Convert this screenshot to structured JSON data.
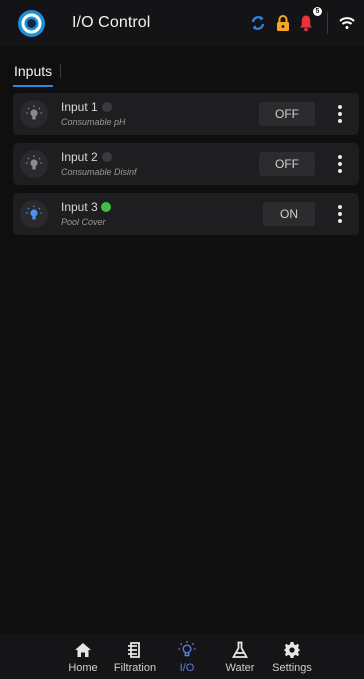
{
  "header": {
    "title": "I/O Control",
    "notification_count": "5",
    "icons": [
      "logo-icon",
      "sync-icon",
      "lock-icon",
      "bell-icon",
      "wifi-icon"
    ],
    "colors": {
      "sync": "#2e88e8",
      "lock": "#f5a623",
      "bell": "#e8343a"
    }
  },
  "tabs": [
    {
      "label": "Inputs",
      "active": true
    }
  ],
  "inputs": [
    {
      "name": "Input 1",
      "subtitle": "Consumable pH",
      "state": "OFF",
      "active": false,
      "dot_color": "#3b3b3e"
    },
    {
      "name": "Input 2",
      "subtitle": "Consumable Disinf",
      "state": "OFF",
      "active": false,
      "dot_color": "#3b3b3e"
    },
    {
      "name": "Input 3",
      "subtitle": "Pool Cover",
      "state": "ON",
      "active": true,
      "dot_color": "#3fbf4a"
    }
  ],
  "nav": {
    "items": [
      {
        "label": "Home",
        "icon": "home-icon",
        "active": false
      },
      {
        "label": "Filtration",
        "icon": "filtration-icon",
        "active": false
      },
      {
        "label": "I/O",
        "icon": "bulb-icon",
        "active": true
      },
      {
        "label": "Water",
        "icon": "flask-icon",
        "active": false
      },
      {
        "label": "Settings",
        "icon": "gear-icon",
        "active": false
      }
    ],
    "accent_color": "#5a7fe0"
  }
}
